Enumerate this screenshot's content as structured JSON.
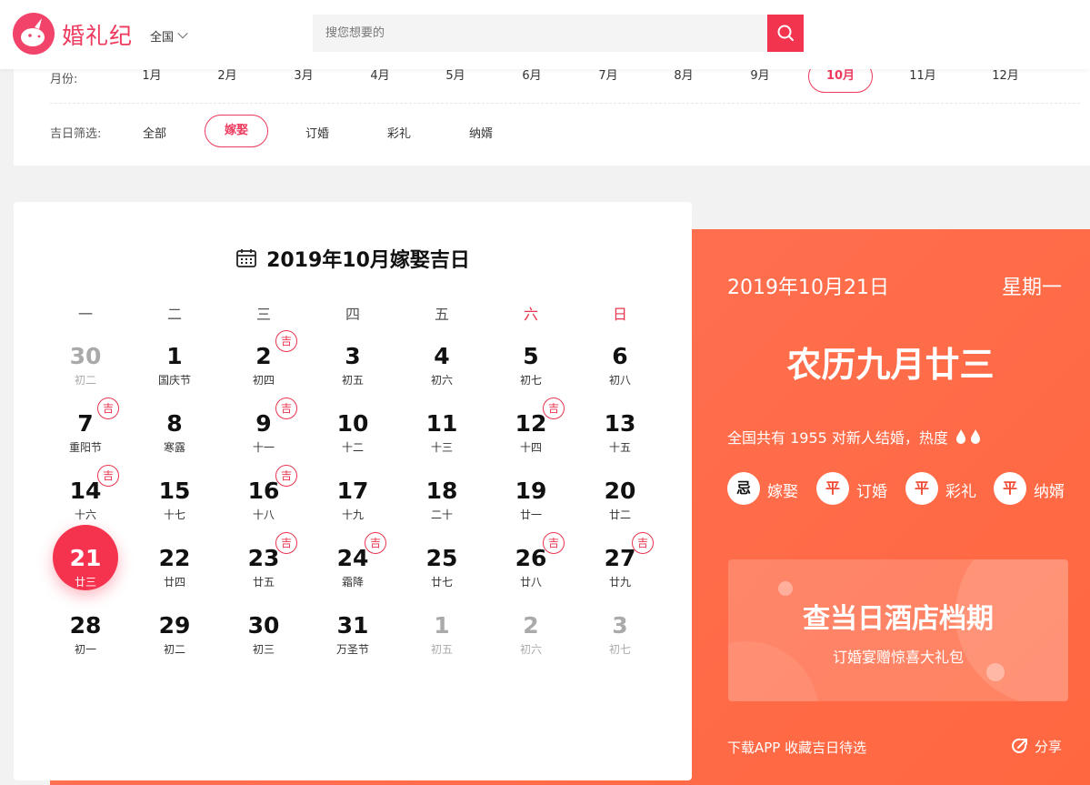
{
  "header": {
    "brand": "婚礼纪",
    "region": "全国",
    "search_placeholder": "搜您想要的"
  },
  "filters": {
    "month_label": "月份:",
    "months": [
      "1月",
      "2月",
      "3月",
      "4月",
      "5月",
      "6月",
      "7月",
      "8月",
      "9月",
      "10月",
      "11月",
      "12月"
    ],
    "active_month": "10月",
    "type_label": "吉日筛选:",
    "types": [
      "全部",
      "嫁娶",
      "订婚",
      "彩礼",
      "纳婿"
    ],
    "active_type": "嫁娶"
  },
  "calendar": {
    "title": "2019年10月嫁娶吉日",
    "weekdays": [
      "一",
      "二",
      "三",
      "四",
      "五",
      "六",
      "日"
    ],
    "auspicious_mark": "吉",
    "days": [
      {
        "d": "30",
        "l": "初二",
        "muted": true
      },
      {
        "d": "1",
        "l": "国庆节"
      },
      {
        "d": "2",
        "l": "初四",
        "ji": true
      },
      {
        "d": "3",
        "l": "初五"
      },
      {
        "d": "4",
        "l": "初六"
      },
      {
        "d": "5",
        "l": "初七"
      },
      {
        "d": "6",
        "l": "初八"
      },
      {
        "d": "7",
        "l": "重阳节",
        "ji": true
      },
      {
        "d": "8",
        "l": "寒露"
      },
      {
        "d": "9",
        "l": "十一",
        "ji": true
      },
      {
        "d": "10",
        "l": "十二"
      },
      {
        "d": "11",
        "l": "十三"
      },
      {
        "d": "12",
        "l": "十四",
        "ji": true
      },
      {
        "d": "13",
        "l": "十五"
      },
      {
        "d": "14",
        "l": "十六",
        "ji": true
      },
      {
        "d": "15",
        "l": "十七"
      },
      {
        "d": "16",
        "l": "十八",
        "ji": true
      },
      {
        "d": "17",
        "l": "十九"
      },
      {
        "d": "18",
        "l": "二十"
      },
      {
        "d": "19",
        "l": "廿一"
      },
      {
        "d": "20",
        "l": "廿二"
      },
      {
        "d": "21",
        "l": "廿三",
        "selected": true
      },
      {
        "d": "22",
        "l": "廿四"
      },
      {
        "d": "23",
        "l": "廿五",
        "ji": true
      },
      {
        "d": "24",
        "l": "霜降",
        "ji": true
      },
      {
        "d": "25",
        "l": "廿七"
      },
      {
        "d": "26",
        "l": "廿八",
        "ji": true
      },
      {
        "d": "27",
        "l": "廿九",
        "ji": true
      },
      {
        "d": "28",
        "l": "初一"
      },
      {
        "d": "29",
        "l": "初二"
      },
      {
        "d": "30",
        "l": "初三"
      },
      {
        "d": "31",
        "l": "万圣节"
      },
      {
        "d": "1",
        "l": "初五",
        "muted": true
      },
      {
        "d": "2",
        "l": "初六",
        "muted": true
      },
      {
        "d": "3",
        "l": "初七",
        "muted": true
      }
    ]
  },
  "detail": {
    "date": "2019年10月21日",
    "weekday": "星期一",
    "lunar": "农历九月廿三",
    "info": "全国共有 1955 对新人结婚，热度",
    "tags": [
      {
        "badge": "忌",
        "label": "嫁娶"
      },
      {
        "badge": "平",
        "label": "订婚"
      },
      {
        "badge": "平",
        "label": "彩礼"
      },
      {
        "badge": "平",
        "label": "纳婿"
      }
    ],
    "promo_title": "查当日酒店档期",
    "promo_sub": "订婚宴赠惊喜大礼包",
    "app_text": "下载APP 收藏吉日待选",
    "share": "分享"
  },
  "colors": {
    "accent": "#ee3a5e",
    "panel": "#ff6d4a"
  }
}
